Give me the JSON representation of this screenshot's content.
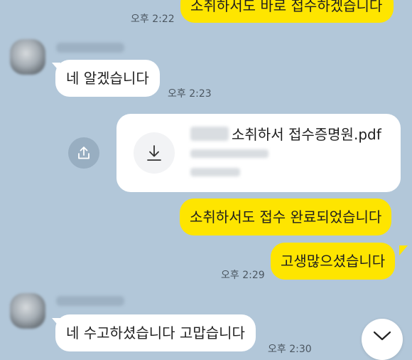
{
  "messages": {
    "m1": {
      "text": "소취하서도 바로 접수하겠습니다",
      "time": "오후 2:22"
    },
    "m2": {
      "text": "네 알겠습니다",
      "time": "오후 2:23"
    },
    "file": {
      "name": "소취하서 접수증명원.pdf"
    },
    "m3": {
      "text": "소취하서도 접수 완료되었습니다"
    },
    "m4": {
      "text": "고생많으셨습니다",
      "time": "오후 2:29"
    },
    "m5": {
      "text": "네 수고하셨습니다 고맙습니다",
      "time": "오후 2:30"
    }
  },
  "icons": {
    "share": "share-icon",
    "download": "download-icon",
    "scroll": "chevron-down-icon"
  },
  "colors": {
    "background": "#b2c7d9",
    "my_bubble": "#fee500",
    "their_bubble": "#ffffff"
  }
}
